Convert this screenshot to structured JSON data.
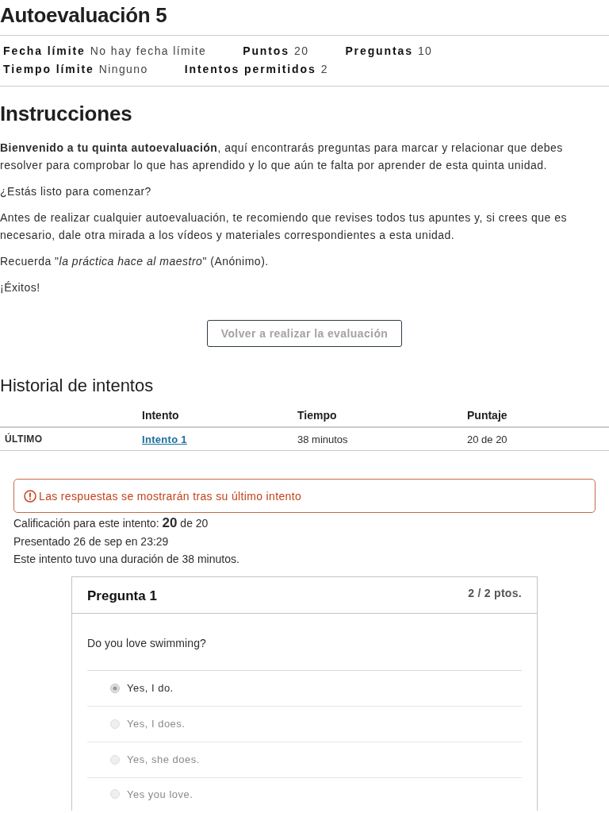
{
  "title": "Autoevaluación 5",
  "detail_rows": [
    {
      "items": [
        {
          "label": "Fecha límite",
          "value": "No hay fecha límite"
        },
        {
          "label": "Puntos",
          "value": "20"
        },
        {
          "label": "Preguntas",
          "value": "10"
        }
      ]
    },
    {
      "items": [
        {
          "label": "Tiempo límite",
          "value": "Ninguno"
        },
        {
          "label": "Intentos permitidos",
          "value": "2"
        }
      ]
    }
  ],
  "instructions": {
    "heading": "Instrucciones",
    "paragraphs": [
      "**Bienvenido a tu quinta autoevaluación**, aquí encontrarás preguntas para marcar y relacionar que debes resolver para comprobar lo que has aprendido y lo que aún te falta por aprender de esta quinta unidad.",
      "¿Estás listo para comenzar?",
      "Antes de realizar cualquier autoevaluación, te recomiendo que revises todos tus apuntes y, si crees que es necesario, dale otra mirada a los vídeos y materiales correspondientes a esta unidad.",
      "Recuerda \"*la práctica hace al maestro*\" (Anónimo).",
      "¡Éxitos!"
    ]
  },
  "retake_button": {
    "label": "Volver a realizar la evaluación",
    "disabled": true
  },
  "history": {
    "heading": "Historial de intentos",
    "columns": [
      "Intento",
      "Tiempo",
      "Puntaje"
    ],
    "rows": [
      {
        "status": "ÚLTIMO",
        "attempt": "Intento 1",
        "time": "38 minutos",
        "score": "20 de 20"
      }
    ]
  },
  "alert": {
    "message": "Las respuestas se mostrarán tras su último intento"
  },
  "summary": [
    "Calificación para este intento: **20** de 20",
    "Presentado 26 de sep en 23:29",
    "Este intento tuvo una duración de 38 minutos."
  ],
  "question": {
    "title": "Pregunta 1",
    "points": "2 / 2 ptos.",
    "text": "Do you love swimming?",
    "answers": [
      {
        "text": "Yes, I do.",
        "selected": true
      },
      {
        "text": "Yes, I does.",
        "selected": false
      },
      {
        "text": "Yes, she does.",
        "selected": false
      },
      {
        "text": "Yes you love.",
        "selected": false
      }
    ]
  }
}
